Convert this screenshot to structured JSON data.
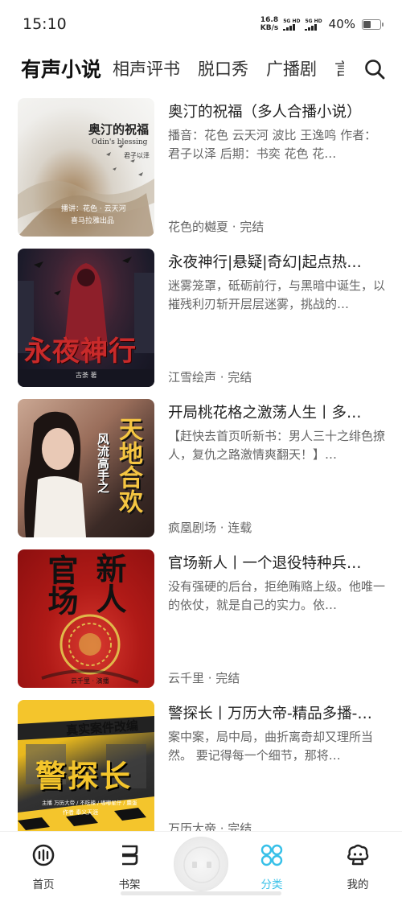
{
  "status_bar": {
    "time": "15:10",
    "net_speed_value": "16.8",
    "net_speed_unit": "KB/s",
    "sim1_label": "5G HD",
    "sim2_label": "5G HD",
    "battery_percent": "40%",
    "battery_level": 0.4
  },
  "tabs": [
    {
      "label": "有声小说",
      "active": true
    },
    {
      "label": "相声评书",
      "active": false
    },
    {
      "label": "脱口秀",
      "active": false
    },
    {
      "label": "广播剧",
      "active": false
    },
    {
      "label": "言",
      "active": false
    }
  ],
  "books": [
    {
      "title": "奥汀的祝福（多人合播小说）",
      "description": "播音：花色 云天河 波比 王逸鸣 作者：君子以泽 后期：书奕 花色 花…",
      "source": "花色的樾夏 · 完结",
      "cover": {
        "title": "奥汀的祝福",
        "subtitle": "Odin's blessing",
        "author": "君子以泽",
        "narrators": "播讲：花色 · 云天河",
        "publisher": "喜马拉雅出品"
      }
    },
    {
      "title": "永夜神行|悬疑|奇幻|起点热…",
      "description": "迷雾笼罩，砥砺前行，与黑暗中诞生，以摧残利刃斩开层层迷雾，挑战的…",
      "source": "江雪绘声 · 完结",
      "cover": {
        "title": "永夜神行",
        "author": "古荼 著"
      }
    },
    {
      "title": "开局桃花格之激荡人生丨多…",
      "description": "【赶快去首页听新书：男人三十之绯色撩人，复仇之路激情爽翻天！】…",
      "source": "疯凰剧场 · 连载",
      "cover": {
        "title_big": "天地合欢",
        "title_small": "风流高手之"
      }
    },
    {
      "title": "官场新人丨一个退役特种兵…",
      "description": "没有强硬的后台，拒绝贿赂上级。他唯一的依仗，就是自己的实力。依…",
      "source": "云千里 · 完结",
      "cover": {
        "title_left": "官场",
        "title_right": "新人",
        "author": "云千里 · 演播"
      }
    },
    {
      "title": "警探长丨万历大帝-精品多播-…",
      "description": "案中案，局中局，曲折离奇却又理所当然。 要记得每一个细节，那将…",
      "source": "万历大帝 · 完结",
      "cover": {
        "banner": "真实案件改编",
        "title": "警探长",
        "narrators": "主播 万历大帝 / 不吃辣 / 嘟嘟星仔 / 麋蛋",
        "author": "作者 奉义天涯"
      }
    }
  ],
  "bottom_nav": [
    {
      "label": "首页",
      "icon": "home-icon",
      "active": false
    },
    {
      "label": "书架",
      "icon": "bookshelf-icon",
      "active": false
    },
    {
      "label": "分类",
      "icon": "category-icon",
      "active": true
    },
    {
      "label": "我的",
      "icon": "profile-icon",
      "active": false
    }
  ],
  "colors": {
    "accent": "#37c0e8",
    "text_primary": "#222222",
    "text_secondary": "#666666"
  }
}
